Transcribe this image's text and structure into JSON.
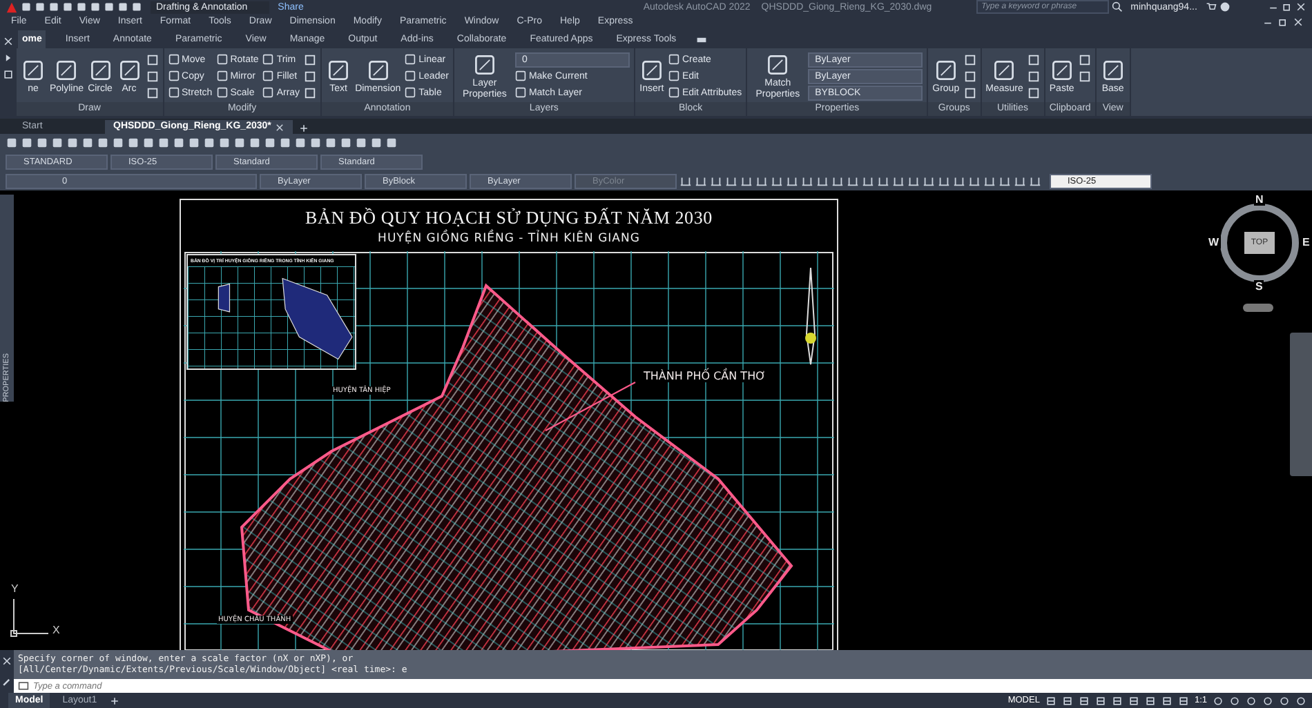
{
  "title_bar": {
    "workspace": "Drafting & Annotation",
    "share": "Share",
    "title": "Autodesk AutoCAD 2022",
    "file": "QHSDDD_Giong_Rieng_KG_2030.dwg",
    "search": {
      "placeholder": "Type a keyword or phrase"
    },
    "user": "minhquang94..."
  },
  "menu": [
    "File",
    "Edit",
    "View",
    "Insert",
    "Format",
    "Tools",
    "Draw",
    "Dimension",
    "Modify",
    "Parametric",
    "Window",
    "C-Pro",
    "Help",
    "Express"
  ],
  "ribbon_tabs": [
    {
      "label": "ome",
      "selected": true
    },
    {
      "label": "Insert",
      "selected": false
    },
    {
      "label": "Annotate",
      "selected": false
    },
    {
      "label": "Parametric",
      "selected": false
    },
    {
      "label": "View",
      "selected": false
    },
    {
      "label": "Manage",
      "selected": false
    },
    {
      "label": "Output",
      "selected": false
    },
    {
      "label": "Add-ins",
      "selected": false
    },
    {
      "label": "Collaborate",
      "selected": false
    },
    {
      "label": "Featured Apps",
      "selected": false
    },
    {
      "label": "Express Tools",
      "selected": false
    }
  ],
  "ribbon_panels": [
    {
      "title": "Draw",
      "tools": [
        {
          "kind": "large",
          "label": "ne"
        },
        {
          "kind": "large",
          "label": "Polyline"
        },
        {
          "kind": "large",
          "label": "Circle"
        },
        {
          "kind": "large",
          "label": "Arc"
        },
        {
          "kind": "icon"
        },
        {
          "kind": "icon"
        },
        {
          "kind": "icon"
        }
      ]
    },
    {
      "title": "Modify",
      "tools": [
        {
          "kind": "small",
          "label": "Move"
        },
        {
          "kind": "small",
          "label": "Copy"
        },
        {
          "kind": "small",
          "label": "Stretch"
        },
        {
          "kind": "small",
          "label": "Rotate"
        },
        {
          "kind": "small",
          "label": "Mirror"
        },
        {
          "kind": "small",
          "label": "Scale"
        },
        {
          "kind": "small",
          "label": "Trim"
        },
        {
          "kind": "small",
          "label": "Fillet"
        },
        {
          "kind": "small",
          "label": "Array"
        },
        {
          "kind": "icon"
        },
        {
          "kind": "icon"
        },
        {
          "kind": "icon"
        }
      ]
    },
    {
      "title": "Annotation",
      "tools": [
        {
          "kind": "large",
          "label": "Text"
        },
        {
          "kind": "large",
          "label": "Dimension"
        },
        {
          "kind": "small",
          "label": "Linear"
        },
        {
          "kind": "small",
          "label": "Leader"
        },
        {
          "kind": "small",
          "label": "Table"
        }
      ]
    },
    {
      "title": "Layers",
      "tools": [
        {
          "kind": "large",
          "label": "Layer Properties"
        },
        {
          "kind": "combo",
          "label": "0"
        },
        {
          "kind": "small",
          "label": "Make Current"
        },
        {
          "kind": "small",
          "label": "Match Layer"
        }
      ]
    },
    {
      "title": "Block",
      "tools": [
        {
          "kind": "large",
          "label": "Insert"
        },
        {
          "kind": "small",
          "label": "Create"
        },
        {
          "kind": "small",
          "label": "Edit"
        },
        {
          "kind": "small",
          "label": "Edit Attributes"
        }
      ]
    },
    {
      "title": "Properties",
      "tools": [
        {
          "kind": "large",
          "label": "Match Properties"
        },
        {
          "kind": "combo",
          "label": "ByLayer"
        },
        {
          "kind": "combo",
          "label": "ByLayer"
        },
        {
          "kind": "combo",
          "label": "BYBLOCK"
        }
      ]
    },
    {
      "title": "Groups",
      "tools": [
        {
          "kind": "large",
          "label": "Group"
        },
        {
          "kind": "icon"
        },
        {
          "kind": "icon"
        },
        {
          "kind": "icon"
        }
      ]
    },
    {
      "title": "Utilities",
      "tools": [
        {
          "kind": "large",
          "label": "Measure"
        },
        {
          "kind": "icon"
        },
        {
          "kind": "icon"
        },
        {
          "kind": "icon"
        }
      ]
    },
    {
      "title": "Clipboard",
      "tools": [
        {
          "kind": "large",
          "label": "Paste"
        },
        {
          "kind": "icon"
        },
        {
          "kind": "icon"
        }
      ]
    },
    {
      "title": "View",
      "tools": [
        {
          "kind": "large",
          "label": "Base"
        }
      ]
    }
  ],
  "doc_tabs": [
    {
      "label": "Start",
      "selected": false
    },
    {
      "label": "QHSDDD_Giong_Rieng_KG_2030*",
      "selected": true
    }
  ],
  "style_toolbar": [
    "STANDARD",
    "ISO-25",
    "Standard",
    "Standard"
  ],
  "layer_toolbar": {
    "layer": "0",
    "color_style": "ByLayer",
    "linetype": "ByBlock",
    "lineweight": "ByLayer",
    "plot_style": {
      "value": "ByColor",
      "disabled": true
    },
    "dim_style": "ISO-25"
  },
  "drawing": {
    "title": "BẢN ĐỒ QUY HOẠCH SỬ DỤNG ĐẤT NĂM 2030",
    "subtitle": "HUYỆN GIỒNG RIỀNG - TỈNH KIÊN GIANG",
    "inset_title": "BẢN ĐỒ VỊ TRÍ HUYỆN GIỒNG RIỀNG TRONG TỈNH KIÊN GIANG",
    "labels": [
      "HUYỆN TÂN HIỆP",
      "THÀNH PHỐ CẦN THƠ",
      "HUYỆN CHÂU THÀNH"
    ]
  },
  "viewcube": {
    "north": "N",
    "south": "S",
    "east": "E",
    "west": "W",
    "face": "TOP"
  },
  "palette": "PROPERTIES",
  "ucs": {
    "x": "X",
    "y": "Y"
  },
  "command": {
    "history": [
      "Specify corner of window, enter a scale factor (nX or nXP), or",
      "[All/Center/Dynamic/Extents/Previous/Scale/Window/Object] <real time>: e"
    ],
    "placeholder": "Type a command"
  },
  "status_bar": {
    "layout_tabs": [
      {
        "label": "Model",
        "selected": true
      },
      {
        "label": "Layout1",
        "selected": false
      }
    ],
    "space": "MODEL",
    "scale": "1:1"
  }
}
